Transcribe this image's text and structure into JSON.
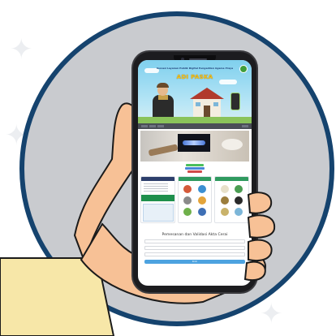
{
  "banner": {
    "small_text": "Inovasi Layanan Publik Digital Pengadilan Agama Praya",
    "title": "ADI PASKA"
  },
  "form": {
    "title": "Pemesanan dan Validasi Akta Cerai",
    "button": "Kirim"
  },
  "colors": {
    "circle_fill": "#c9cbcf",
    "circle_border": "#15436e",
    "skin": "#f7c196",
    "sleeve": "#f7e7a8",
    "banner_title": "#f6c315",
    "form_button": "#4da3e0"
  }
}
